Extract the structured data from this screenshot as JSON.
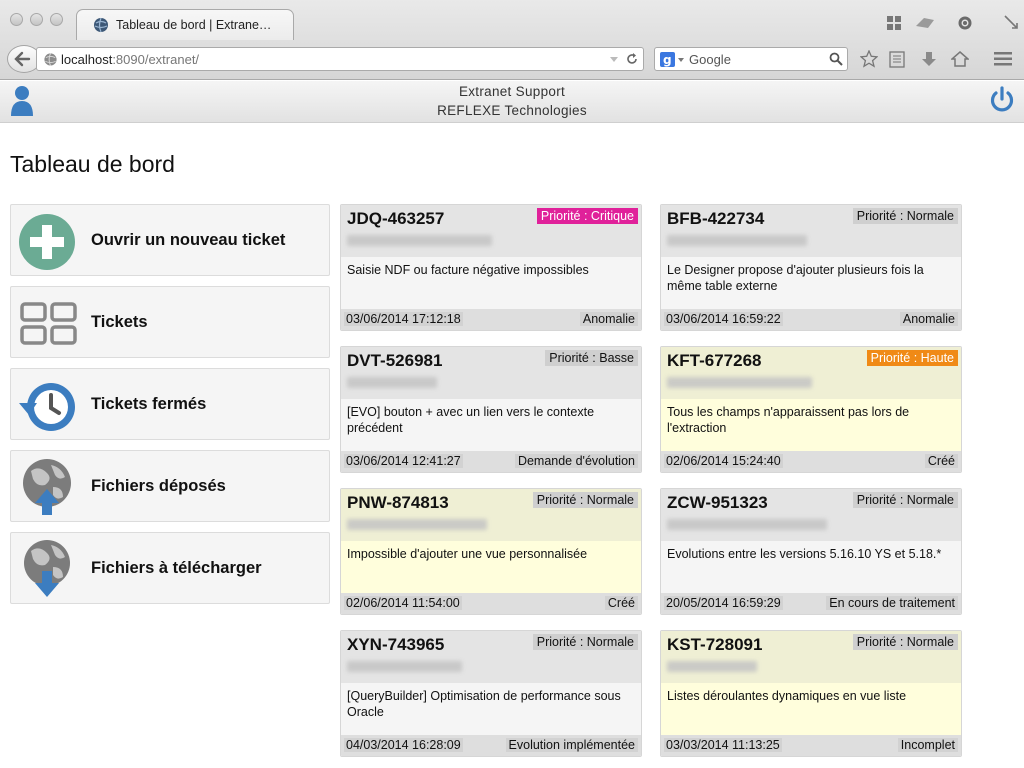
{
  "browser": {
    "tab_title": "Tableau de bord | Extrane…",
    "url_host": "localhost",
    "url_port_path": ":8090/extranet/",
    "search_placeholder": "Google"
  },
  "header": {
    "line1": "Extranet Support",
    "line2": "REFLEXE Technologies"
  },
  "page_title": "Tableau de bord",
  "menu": [
    {
      "label": "Ouvrir un nouveau ticket",
      "icon": "plus-circle-icon"
    },
    {
      "label": "Tickets",
      "icon": "grid-icon"
    },
    {
      "label": "Tickets fermés",
      "icon": "history-clock-icon"
    },
    {
      "label": "Fichiers déposés",
      "icon": "globe-upload-icon"
    },
    {
      "label": "Fichiers à télécharger",
      "icon": "globe-download-icon"
    }
  ],
  "tickets": [
    {
      "id": "JDQ-463257",
      "priority": "Priorité : Critique",
      "level": "crit",
      "color": "grey",
      "desc": "Saisie NDF ou facture négative impossibles",
      "date": "03/06/2014 17:12:18",
      "type": "Anomalie"
    },
    {
      "id": "BFB-422734",
      "priority": "Priorité : Normale",
      "level": "normal",
      "color": "grey",
      "desc": "Le Designer propose d'ajouter plusieurs fois la même table externe",
      "date": "03/06/2014 16:59:22",
      "type": "Anomalie"
    },
    {
      "id": "DVT-526981",
      "priority": "Priorité : Basse",
      "level": "normal",
      "color": "grey",
      "desc": "[EVO] bouton + avec un lien vers le contexte précédent",
      "date": "03/06/2014 12:41:27",
      "type": "Demande d'évolution"
    },
    {
      "id": "KFT-677268",
      "priority": "Priorité : Haute",
      "level": "haute",
      "color": "yellow",
      "desc": "Tous les champs n'apparaissent pas lors de l'extraction",
      "date": "02/06/2014 15:24:40",
      "type": "Créé"
    },
    {
      "id": "PNW-874813",
      "priority": "Priorité : Normale",
      "level": "normal",
      "color": "yellow",
      "desc": "Impossible d'ajouter une vue personnalisée",
      "date": "02/06/2014 11:54:00",
      "type": "Créé"
    },
    {
      "id": "ZCW-951323",
      "priority": "Priorité : Normale",
      "level": "normal",
      "color": "grey",
      "desc": "Evolutions entre les versions 5.16.10 YS et 5.18.*",
      "date": "20/05/2014 16:59:29",
      "type": "En cours de traitement"
    },
    {
      "id": "XYN-743965",
      "priority": "Priorité : Normale",
      "level": "normal",
      "color": "grey",
      "desc": "[QueryBuilder] Optimisation de performance sous Oracle",
      "date": "04/03/2014 16:28:09",
      "type": "Evolution implémentée"
    },
    {
      "id": "KST-728091",
      "priority": "Priorité : Normale",
      "level": "normal",
      "color": "yellow",
      "desc": "Listes déroulantes dynamiques en vue liste",
      "date": "03/03/2014 11:13:25",
      "type": "Incomplet"
    }
  ],
  "colors": {
    "accent_blue": "#3c7dc0",
    "teal": "#6bab94",
    "critical": "#e0219a",
    "high": "#f08a16"
  }
}
